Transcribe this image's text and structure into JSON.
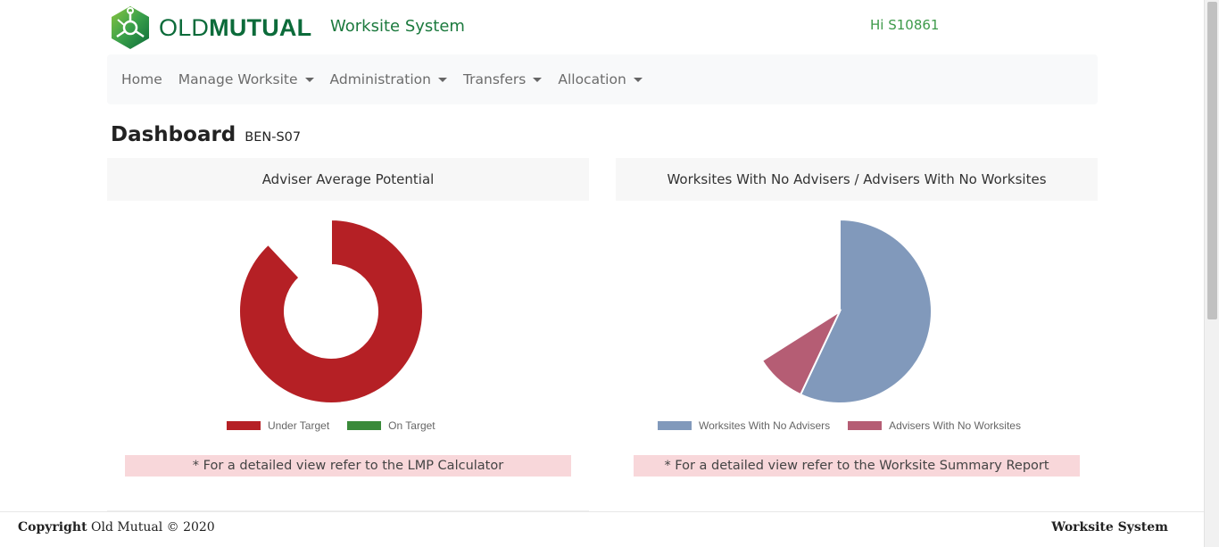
{
  "header": {
    "logo_light": "OLD",
    "logo_bold": "MUTUAL",
    "system_title": "Worksite System",
    "greeting": "Hi S10861"
  },
  "nav": {
    "items": [
      {
        "label": "Home",
        "dropdown": false
      },
      {
        "label": "Manage Worksite",
        "dropdown": true
      },
      {
        "label": "Administration",
        "dropdown": true
      },
      {
        "label": "Transfers",
        "dropdown": true
      },
      {
        "label": "Allocation",
        "dropdown": true
      }
    ]
  },
  "page": {
    "title": "Dashboard",
    "subtitle": "BEN-S07"
  },
  "chart_data": [
    {
      "type": "pie",
      "variant": "doughnut",
      "title": "Adviser Average Potential",
      "categories": [
        "Under Target",
        "On Target"
      ],
      "values": [
        88,
        0
      ],
      "colors": [
        "#b52025",
        "#3a8a3a"
      ],
      "legend": "bottom",
      "note": "* For a detailed view refer to the LMP Calculator"
    },
    {
      "type": "pie",
      "title": "Worksites With No Advisers / Advisers With No Worksites",
      "categories": [
        "Worksites With No Advisers",
        "Advisers With No Worksites"
      ],
      "values": [
        57,
        9
      ],
      "colors": [
        "#8199bb",
        "#b55d74"
      ],
      "legend": "bottom",
      "note": "* For a detailed view refer to the Worksite Summary Report"
    }
  ],
  "footer": {
    "copyright_label": "Copyright",
    "copyright_text": "Old Mutual © 2020",
    "brand": "Worksite System"
  },
  "colors": {
    "brand_green": "#0c6b3a",
    "nav_bg": "#f8f9fa",
    "note_bg": "#f8d7da"
  }
}
